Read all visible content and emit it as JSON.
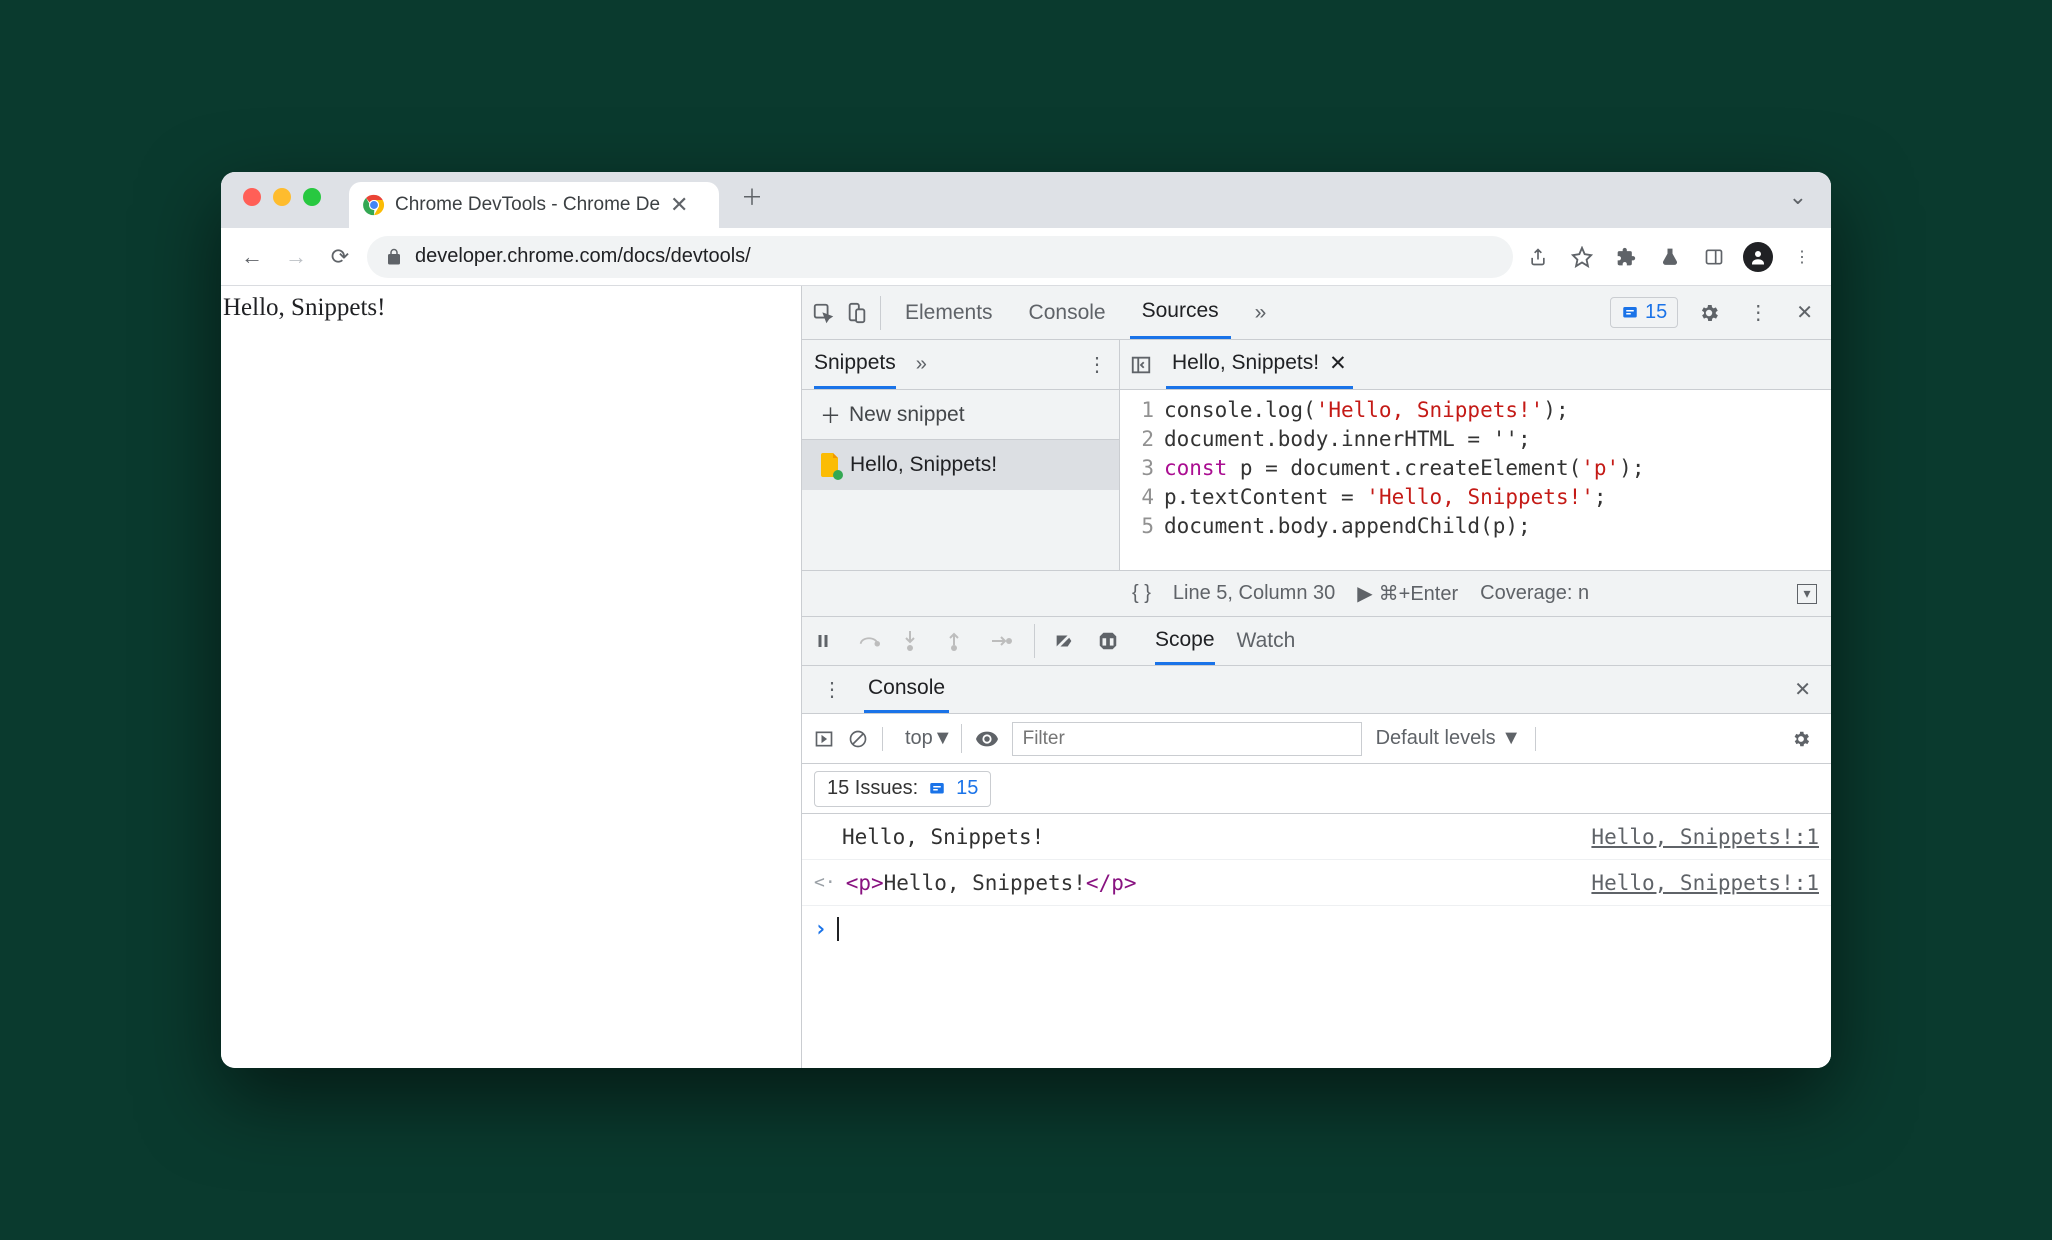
{
  "browser": {
    "tab_title": "Chrome DevTools - Chrome De",
    "url": "developer.chrome.com/docs/devtools/"
  },
  "page": {
    "body_text": "Hello, Snippets!"
  },
  "devtools": {
    "tabs": {
      "elements": "Elements",
      "console": "Console",
      "sources": "Sources"
    },
    "issues_count": "15",
    "snippets": {
      "tab_label": "Snippets",
      "new_label": "New snippet",
      "items": [
        {
          "name": "Hello, Snippets!"
        }
      ]
    },
    "editor": {
      "open_file": "Hello, Snippets!",
      "lines": [
        {
          "n": "1",
          "pre": "console.log(",
          "str": "'Hello, Snippets!'",
          "post": ");"
        },
        {
          "n": "2",
          "text": "document.body.innerHTML = '';"
        },
        {
          "n": "3",
          "kw": "const",
          "text2": " p = document.createElement(",
          "str": "'p'",
          "post": ");"
        },
        {
          "n": "4",
          "pre": "p.textContent = ",
          "str": "'Hello, Snippets!'",
          "post": ";"
        },
        {
          "n": "5",
          "text": "document.body.appendChild(p);"
        }
      ],
      "status_pos": "Line 5, Column 30",
      "run_hint": "⌘+Enter",
      "coverage": "Coverage: n"
    },
    "debugger": {
      "scope": "Scope",
      "watch": "Watch"
    },
    "console": {
      "tab": "Console",
      "context": "top",
      "filter_placeholder": "Filter",
      "levels": "Default levels",
      "issues_label": "15 Issues:",
      "issues_badge": "15",
      "logs": [
        {
          "msg": "Hello, Snippets!",
          "src": "Hello, Snippets!:1"
        },
        {
          "html_open": "<p>",
          "html_text": "Hello, Snippets!",
          "html_close": "</p>",
          "src": "Hello, Snippets!:1"
        }
      ]
    }
  }
}
